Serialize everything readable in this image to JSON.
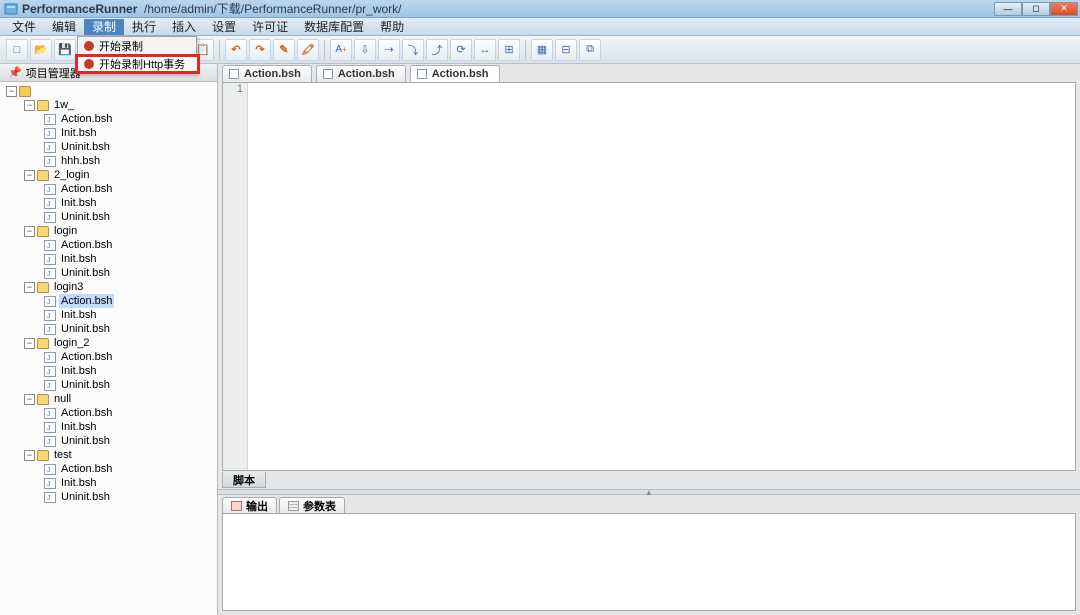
{
  "title_app": "PerformanceRunner",
  "title_path": "/home/admin/下载/PerformanceRunner/pr_work/",
  "menubar": [
    "文件",
    "编辑",
    "录制",
    "执行",
    "插入",
    "设置",
    "许可证",
    "数据库配置",
    "帮助"
  ],
  "menubar_active_index": 2,
  "dropdown": {
    "item1": "开始录制",
    "item2": "开始录制Http事务"
  },
  "sidebar_title": "项目管理器",
  "tree": [
    {
      "lvl": 0,
      "type": "root",
      "label": "",
      "toggle": true
    },
    {
      "lvl": 1,
      "type": "folder",
      "label": "1w_",
      "toggle": true
    },
    {
      "lvl": 2,
      "type": "file",
      "label": "Action.bsh"
    },
    {
      "lvl": 2,
      "type": "file",
      "label": "Init.bsh"
    },
    {
      "lvl": 2,
      "type": "file",
      "label": "Uninit.bsh"
    },
    {
      "lvl": 2,
      "type": "file",
      "label": "hhh.bsh"
    },
    {
      "lvl": 1,
      "type": "folder",
      "label": "2_login",
      "toggle": true
    },
    {
      "lvl": 2,
      "type": "file",
      "label": "Action.bsh"
    },
    {
      "lvl": 2,
      "type": "file",
      "label": "Init.bsh"
    },
    {
      "lvl": 2,
      "type": "file",
      "label": "Uninit.bsh"
    },
    {
      "lvl": 1,
      "type": "folder",
      "label": "login",
      "toggle": true
    },
    {
      "lvl": 2,
      "type": "file",
      "label": "Action.bsh"
    },
    {
      "lvl": 2,
      "type": "file",
      "label": "Init.bsh"
    },
    {
      "lvl": 2,
      "type": "file",
      "label": "Uninit.bsh"
    },
    {
      "lvl": 1,
      "type": "folder",
      "label": "login3",
      "toggle": true
    },
    {
      "lvl": 2,
      "type": "file",
      "label": "Action.bsh",
      "selected": true
    },
    {
      "lvl": 2,
      "type": "file",
      "label": "Init.bsh"
    },
    {
      "lvl": 2,
      "type": "file",
      "label": "Uninit.bsh"
    },
    {
      "lvl": 1,
      "type": "folder",
      "label": "login_2",
      "toggle": true
    },
    {
      "lvl": 2,
      "type": "file",
      "label": "Action.bsh"
    },
    {
      "lvl": 2,
      "type": "file",
      "label": "Init.bsh"
    },
    {
      "lvl": 2,
      "type": "file",
      "label": "Uninit.bsh"
    },
    {
      "lvl": 1,
      "type": "folder",
      "label": "null",
      "toggle": true
    },
    {
      "lvl": 2,
      "type": "file",
      "label": "Action.bsh"
    },
    {
      "lvl": 2,
      "type": "file",
      "label": "Init.bsh"
    },
    {
      "lvl": 2,
      "type": "file",
      "label": "Uninit.bsh"
    },
    {
      "lvl": 1,
      "type": "folder",
      "label": "test",
      "toggle": true
    },
    {
      "lvl": 2,
      "type": "file",
      "label": "Action.bsh"
    },
    {
      "lvl": 2,
      "type": "file",
      "label": "Init.bsh"
    },
    {
      "lvl": 2,
      "type": "file",
      "label": "Uninit.bsh"
    }
  ],
  "doc_tabs": [
    "Action.bsh",
    "Action.bsh",
    "Action.bsh"
  ],
  "gutter_line": "1",
  "bottom_tab": "脚本",
  "lower_tabs": [
    "输出",
    "参数表"
  ],
  "toolbar_icons": [
    "new",
    "open",
    "save",
    "sep",
    "record",
    "tree",
    "sep",
    "cut",
    "copy",
    "paste",
    "sep",
    "undo",
    "redo",
    "find",
    "highlight",
    "sep",
    "A+",
    "export",
    "step",
    "step-into",
    "step-out",
    "sync",
    "ruler",
    "align",
    "sep",
    "grid",
    "table",
    "multi"
  ]
}
